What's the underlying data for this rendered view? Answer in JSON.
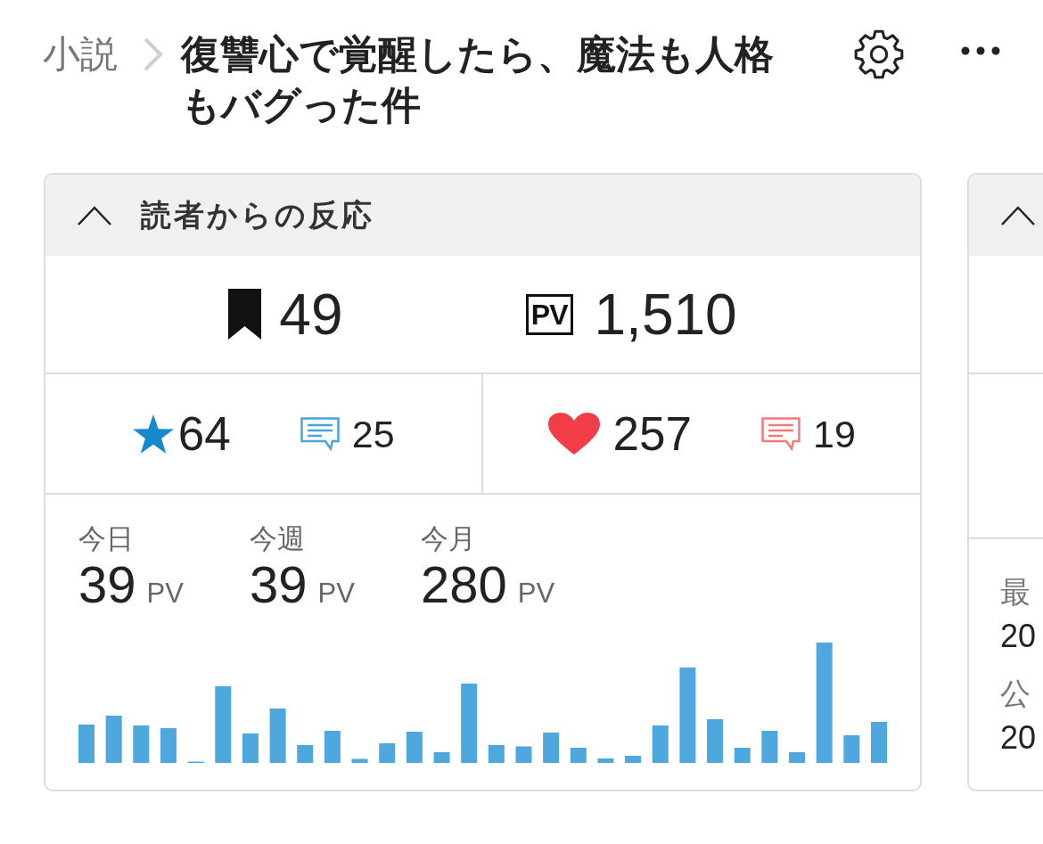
{
  "breadcrumb": {
    "parent": "小説",
    "title": "復讐心で覚醒したら、魔法も人格もバグった件"
  },
  "reactions_panel": {
    "title": "読者からの反応",
    "expanded": true,
    "totals": [
      {
        "kind": "bookmarks",
        "value": "49"
      },
      {
        "kind": "page_views",
        "badge": "PV",
        "value": "1,510"
      }
    ],
    "reaction_groups": [
      {
        "kind": "stars",
        "count": "64",
        "comments": "25"
      },
      {
        "kind": "hearts",
        "count": "257",
        "comments": "19"
      }
    ],
    "period_views": [
      {
        "label": "今日",
        "value": "39",
        "unit": "PV"
      },
      {
        "label": "今週",
        "value": "39",
        "unit": "PV"
      },
      {
        "label": "今月",
        "value": "280",
        "unit": "PV"
      }
    ]
  },
  "side_panel": {
    "expanded": true,
    "fields": [
      {
        "label": "最",
        "value": "20"
      },
      {
        "label": "公",
        "value": "20"
      }
    ]
  }
}
